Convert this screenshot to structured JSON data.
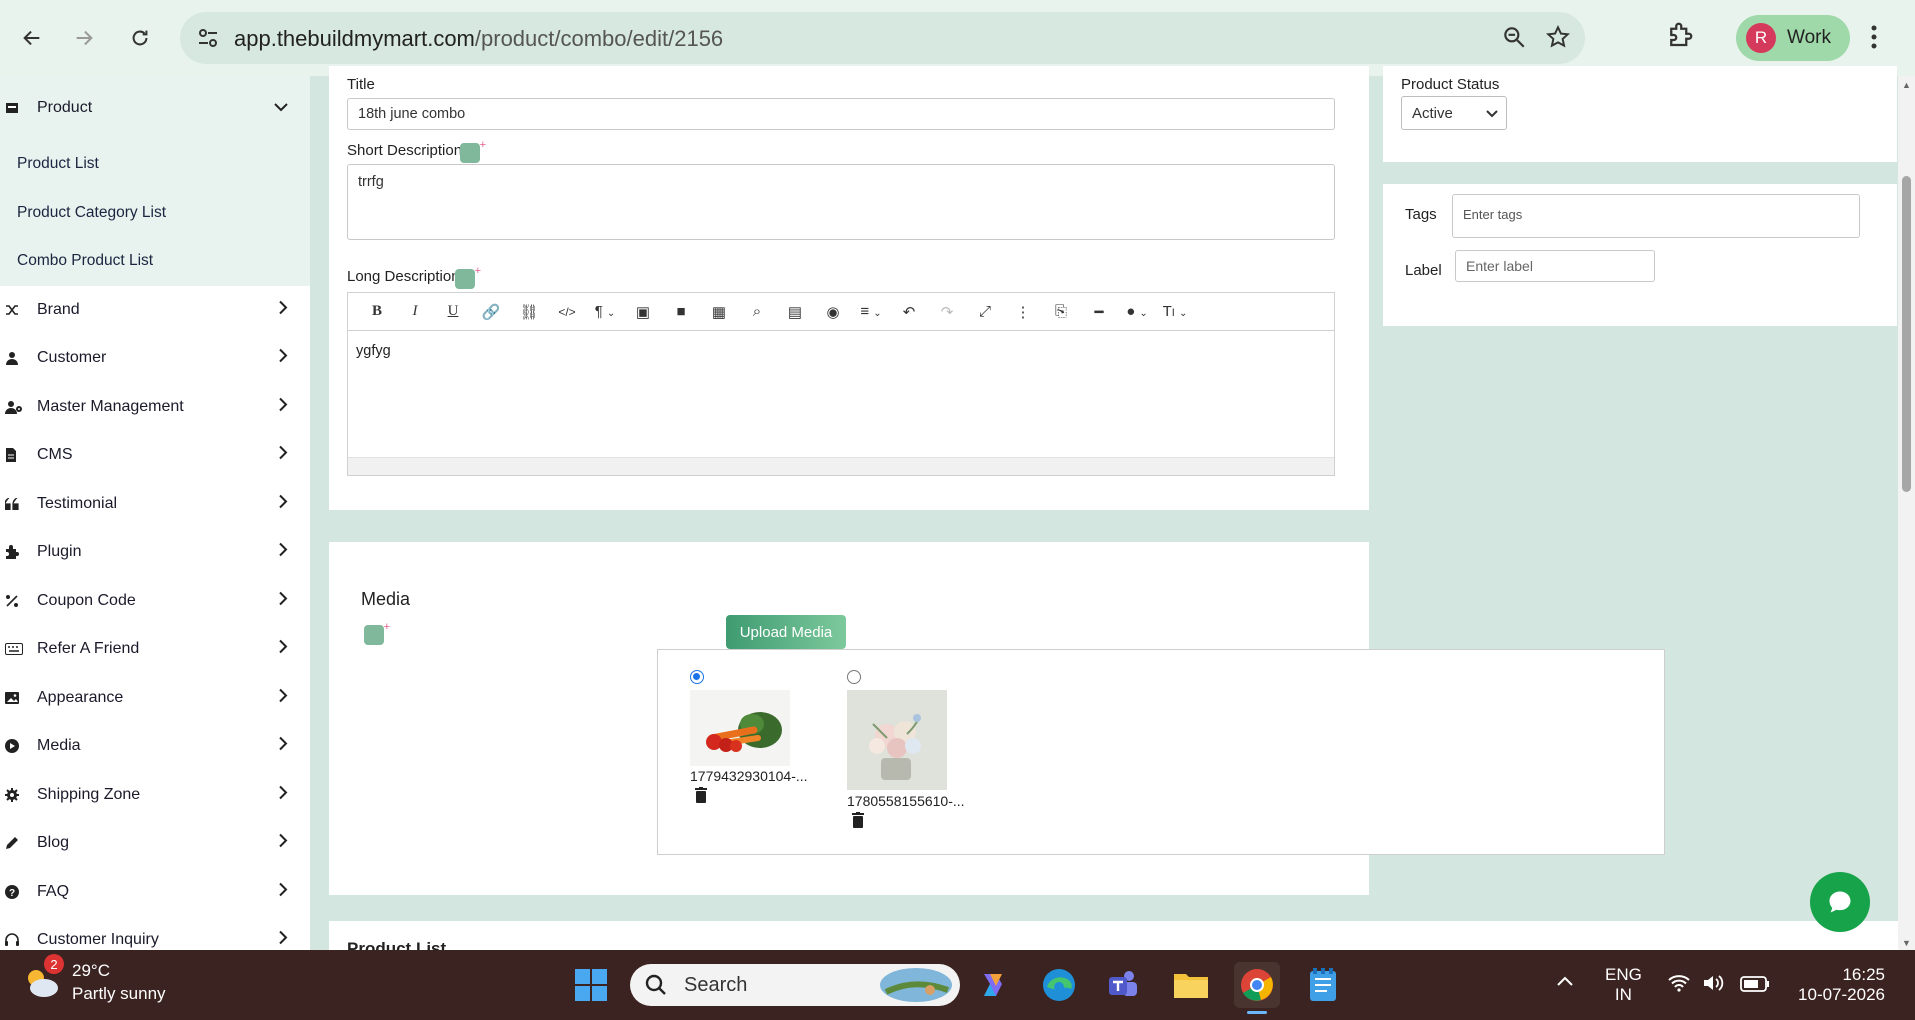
{
  "browser": {
    "url_host": "app.thebuildmymart.com",
    "url_path": "/product/combo/edit/2156",
    "profile_initial": "R",
    "profile_label": "Work"
  },
  "sidebar": {
    "product": {
      "label": "Product",
      "children": [
        "Product List",
        "Product Category List",
        "Combo Product List"
      ]
    },
    "items": [
      {
        "label": "Brand",
        "icon": "shuffle-icon"
      },
      {
        "label": "Customer",
        "icon": "user-icon"
      },
      {
        "label": "Master Management",
        "icon": "users-cog-icon"
      },
      {
        "label": "CMS",
        "icon": "file-icon"
      },
      {
        "label": "Testimonial",
        "icon": "quote-icon"
      },
      {
        "label": "Plugin",
        "icon": "puzzle-icon"
      },
      {
        "label": "Coupon Code",
        "icon": "percent-icon"
      },
      {
        "label": "Refer A Friend",
        "icon": "keyboard-icon"
      },
      {
        "label": "Appearance",
        "icon": "image-icon"
      },
      {
        "label": "Media",
        "icon": "play-circle-icon"
      },
      {
        "label": "Shipping Zone",
        "icon": "gear-icon"
      },
      {
        "label": "Blog",
        "icon": "pen-icon"
      },
      {
        "label": "FAQ",
        "icon": "question-circle-icon"
      },
      {
        "label": "Customer Inquiry",
        "icon": "headset-icon"
      }
    ]
  },
  "form": {
    "title_label": "Title",
    "title_value": "18th june combo",
    "short_desc_label": "Short Description",
    "short_desc_value": "trrfg",
    "long_desc_label": "Long Description",
    "long_desc_value": "ygfyg",
    "toolbar_buttons": [
      "B",
      "I",
      "U"
    ]
  },
  "media": {
    "title": "Media",
    "upload_label": "Upload Media",
    "files": [
      {
        "name": "1779432930104-...",
        "selected": true
      },
      {
        "name": "1780558155610-...",
        "selected": false
      }
    ]
  },
  "product_list_heading": "Product List",
  "status": {
    "label": "Product Status",
    "value": "Active"
  },
  "tags": {
    "tags_label": "Tags",
    "tags_placeholder": "Enter tags",
    "label_label": "Label",
    "label_placeholder": "Enter label"
  },
  "taskbar": {
    "weather_temp": "29°C",
    "weather_cond": "Partly sunny",
    "weather_badge": "2",
    "search_placeholder": "Search",
    "lang1": "ENG",
    "lang2": "IN",
    "time": "16:25",
    "date": "10-07-2026"
  },
  "colors": {
    "accent_green": "#3f9b71",
    "page_bg": "#d3e6df",
    "chat_fab": "#16a34a"
  }
}
